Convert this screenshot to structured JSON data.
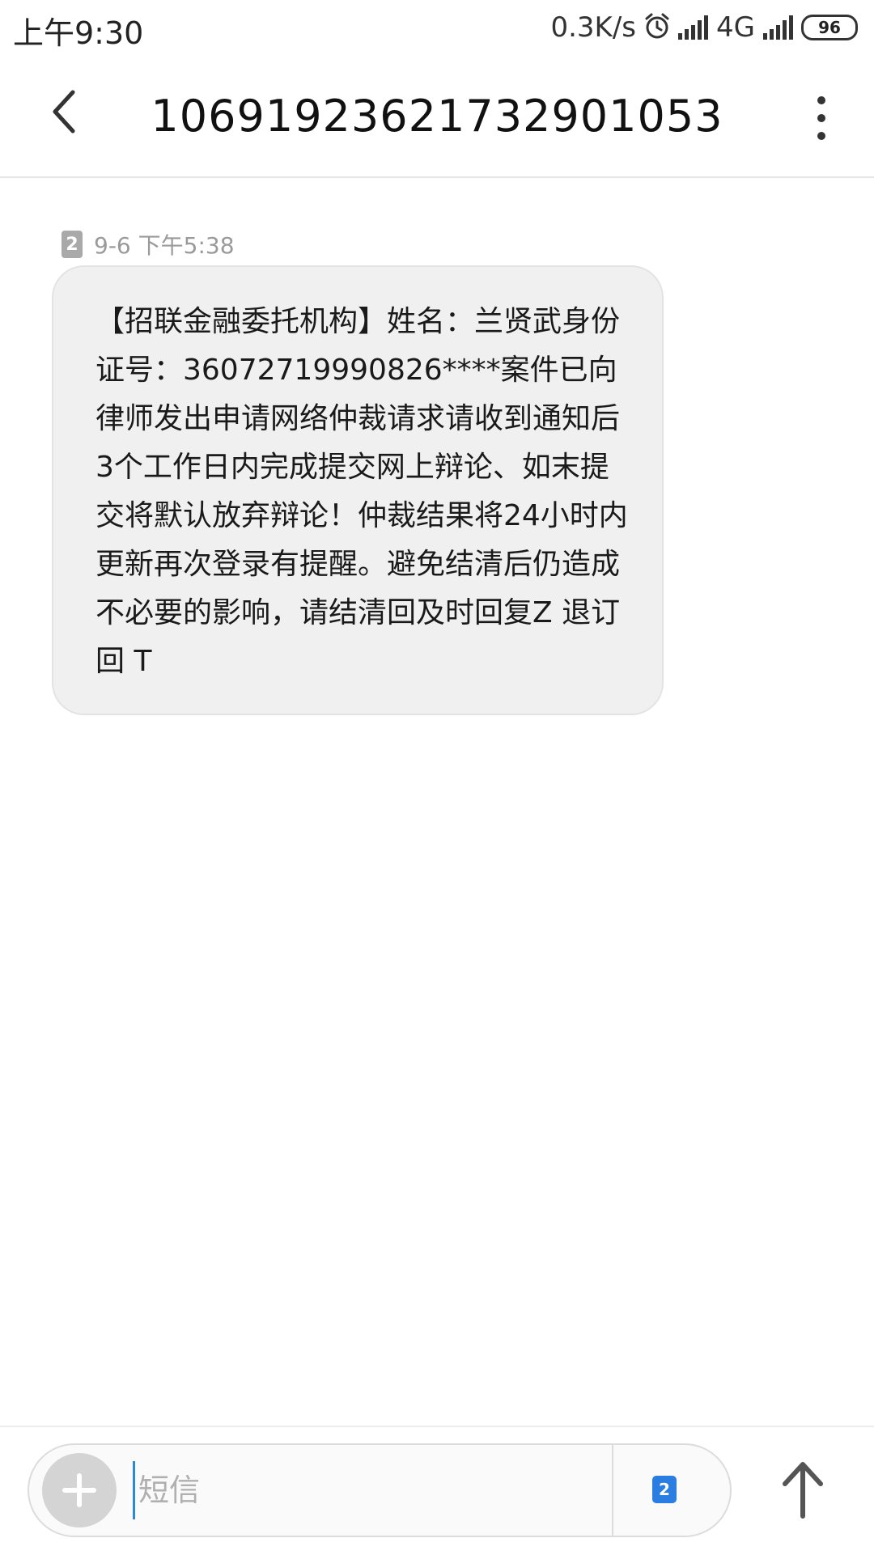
{
  "status_bar": {
    "time": "上午9:30",
    "speed": "0.3K/s",
    "network": "4G",
    "battery": "96",
    "icons": [
      "alarm-icon",
      "signal-icon",
      "signal-icon",
      "battery-icon"
    ]
  },
  "header": {
    "title": "10691923621732901053",
    "back_icon": "chevron-left-icon",
    "more_icon": "more-vertical-icon"
  },
  "message": {
    "sim": "2",
    "time": "9-6 下午5:38",
    "body": "【招联金融委托机构】姓名：兰贤武身份证号：36072719990826****案件已向律师发出申请网络仲裁请求请收到通知后3个工作日内完成提交网上辩论、如末提交将默认放弃辩论！仲裁结果将24小时内更新再次登录有提醒。避免结清后仍造成不必要的影响，请结清回及时回复Z 退订回 T"
  },
  "composer": {
    "placeholder": "短信",
    "value": "",
    "sim": "2",
    "add_icon": "plus-icon",
    "send_icon": "arrow-up-icon"
  },
  "colors": {
    "bubble_bg": "#f0f0f0",
    "sim_active": "#2a7de1",
    "cursor": "#2a8ad8"
  }
}
